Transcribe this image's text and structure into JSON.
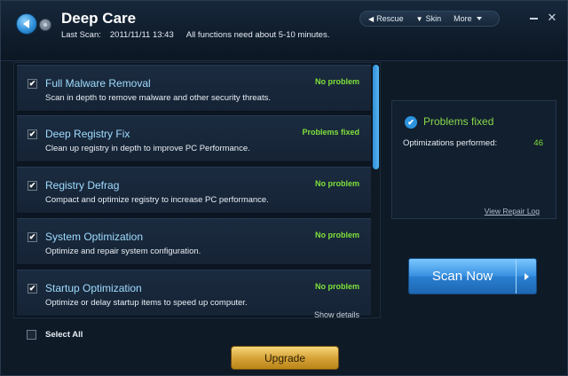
{
  "header": {
    "title": "Deep Care",
    "last_scan_label": "Last Scan:",
    "last_scan_datetime": "2011/11/11 13:43",
    "functions_note": "All functions need about 5-10 minutes.",
    "back_icon": "back-arrow-icon",
    "forward_icon": "forward-icon"
  },
  "topmenu": {
    "rescue": "Rescue",
    "skin": "Skin",
    "more": "More",
    "rescue_icon": "back-arrow-icon",
    "skin_icon": "shirt-icon"
  },
  "window_controls": {
    "close_glyph": "✕"
  },
  "items": [
    {
      "title": "Full Malware Removal",
      "desc": "Scan in depth to remove malware and other security threats.",
      "status": "No problem",
      "details": "",
      "checked": true
    },
    {
      "title": "Deep Registry Fix",
      "desc": "Clean up registry in depth to improve PC Performance.",
      "status": "Problems fixed",
      "details": "",
      "checked": true
    },
    {
      "title": "Registry Defrag",
      "desc": "Compact and optimize registry to increase PC performance.",
      "status": "No problem",
      "details": "",
      "checked": true
    },
    {
      "title": "System Optimization",
      "desc": "Optimize and repair system configuration.",
      "status": "No problem",
      "details": "",
      "checked": true
    },
    {
      "title": "Startup Optimization",
      "desc": "Optimize or delay startup items to speed up computer.",
      "status": "No problem",
      "details": "Show details",
      "checked": true
    }
  ],
  "result": {
    "title": "Problems fixed",
    "optimizations_label": "Optimizations performed:",
    "optimizations_value": "46",
    "view_log": "View Repair Log"
  },
  "actions": {
    "scan_now": "Scan Now",
    "select_all": "Select All",
    "upgrade": "Upgrade"
  },
  "colors": {
    "accent": "#2f8fd8",
    "status_green": "#7ee03a",
    "upgrade_gold": "#d7a43a"
  }
}
